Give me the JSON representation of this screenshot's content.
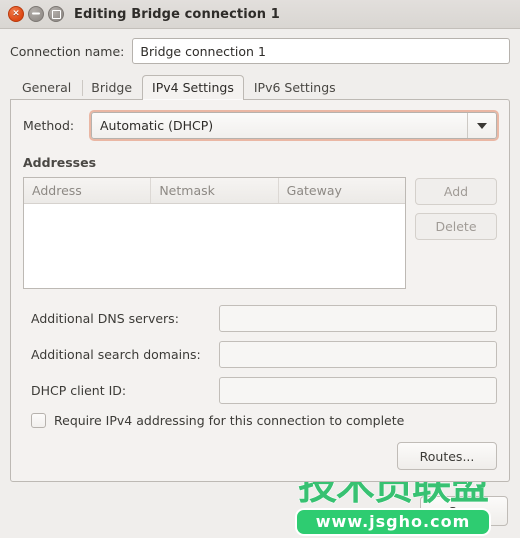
{
  "window": {
    "title": "Editing Bridge connection 1",
    "buttons": {
      "close": "×",
      "minimize": "−",
      "maximize": "□"
    }
  },
  "connection": {
    "label": "Connection name:",
    "value": "Bridge connection 1",
    "placeholder": ""
  },
  "tabs": [
    {
      "label": "General",
      "active": false
    },
    {
      "label": "Bridge",
      "active": false
    },
    {
      "label": "IPv4 Settings",
      "active": true
    },
    {
      "label": "IPv6 Settings",
      "active": false
    }
  ],
  "ipv4": {
    "method": {
      "label": "Method:",
      "value": "Automatic (DHCP)",
      "focus_color": "#dd6e46"
    },
    "addresses": {
      "section_label": "Addresses",
      "columns": [
        "Address",
        "Netmask",
        "Gateway"
      ],
      "rows": [],
      "add_button": "Add",
      "delete_button": "Delete"
    },
    "fields": [
      {
        "label": "Additional DNS servers:",
        "value": "",
        "placeholder": ""
      },
      {
        "label": "Additional search domains:",
        "value": "",
        "placeholder": ""
      },
      {
        "label": "DHCP client ID:",
        "value": "",
        "placeholder": ""
      }
    ],
    "require_ipv4": {
      "label": "Require IPv4 addressing for this connection to complete",
      "checked": false
    },
    "routes_button": "Routes..."
  },
  "footer": {
    "save_button": "Save"
  },
  "watermark": {
    "text_cn": "技术员联盟",
    "url": "www.jsgho.com",
    "color": "#2ecc71"
  }
}
